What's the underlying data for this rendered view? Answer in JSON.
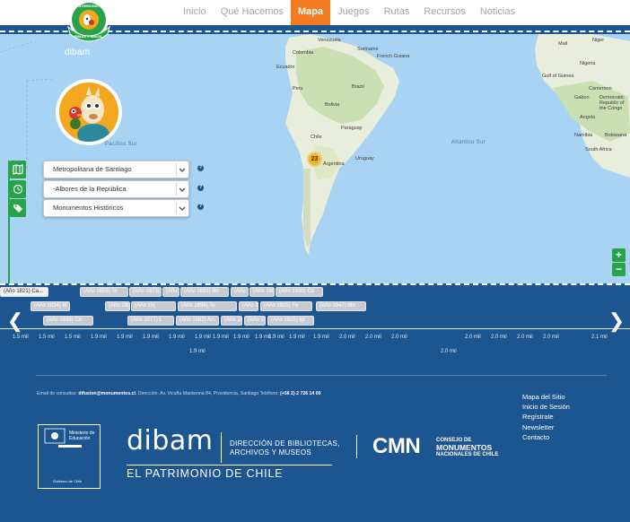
{
  "nav": {
    "items": [
      "Inicio",
      "Qué Hacemos",
      "Mapa",
      "Juegos",
      "Rutas",
      "Recursos",
      "Noticias"
    ],
    "active": "Mapa"
  },
  "logo": {
    "badge_top": "PATRIMONIO",
    "badge_bottom": "RIMAS Y NIÑOS",
    "brand": "dibam"
  },
  "map": {
    "ocean_labels": [
      "Pacífico Sur",
      "Atlántico Sur"
    ],
    "country_labels": [
      "Venezuela",
      "Colombia",
      "Suriname",
      "French Guiana",
      "Ecuador",
      "Peru",
      "Brazil",
      "Bolivia",
      "Paraguay",
      "Chile",
      "Argentina",
      "Uruguay",
      "Mali",
      "Niger",
      "Nigeria",
      "Cameroon",
      "Gabon",
      "Democratic Republic of the Congo",
      "Angola",
      "Namibia",
      "Botswana",
      "South Africa",
      "Gulf of Guinea"
    ],
    "cluster_count": "23",
    "zoom_in": "+",
    "zoom_out": "−"
  },
  "filters": [
    {
      "icon": "map-icon",
      "value": "Metropolitana de Santiago",
      "help": "?"
    },
    {
      "icon": "clock-icon",
      "value": "-Albores de la República",
      "help": "?"
    },
    {
      "icon": "tag-icon",
      "value": "Monumentos Históricos",
      "help": "?"
    }
  ],
  "timeline": {
    "events_row1": [
      "(Año 1821) Ca...",
      "(Año 1853) Te",
      "(Año 1873) De",
      "(Año 1",
      "(Año 1893) Bo",
      "(Año",
      "(Año 18(",
      "(Año 1930) Ca"
    ],
    "events_row2": [
      "(Año 1834) Id",
      "(Año 18(",
      "(Año 18(",
      "(Año 1896) Te",
      "(Año 1",
      "(Año 1925) Fu",
      "(Año 1947) Mo"
    ],
    "events_row3": [
      "(Año 1838) Co",
      "(Año 1877) L",
      "(Año 1882) Arc",
      "(Año 18",
      "(Año 18",
      "(Año 1925) Igl"
    ],
    "ticks": [
      "1.5 mil",
      "1.5 mil",
      "1.5 mil",
      "1.9 mil",
      "1.9 mil",
      "1.9 mil",
      "1.9 mil",
      "1.9 mil",
      "1.9 mil",
      "1.9 mil",
      "1.9 mil",
      "1.9 mil",
      "1.9 mil",
      "1.9 mil",
      "2.0 mil",
      "2.0 mil",
      "2.0 mil",
      "2.0 mil",
      "2.0 mil",
      "2.0 mil",
      "2.0 mil",
      "2.1 mil"
    ],
    "majors": [
      "1.9 mil",
      "2.0 mil"
    ],
    "prev": "❮",
    "next": "❯"
  },
  "footer": {
    "contact_prefix": "Email de consultas: ",
    "email": "difusion@monumentos.cl",
    "address": ". Dirección: Av. Vicuña Mackenna 84, Providencia, Santiago Teléfono: ",
    "phone": "(+56 2) 2 726 14 00",
    "links": [
      "Mapa del Sitio",
      "Inicio de Sesión",
      "Regístrate",
      "Newsletter",
      "Contacto"
    ],
    "mineduc_line1": "Ministerio de",
    "mineduc_line2": "Educación",
    "gobierno": "Gobierno de Chile",
    "dibam": "dibam",
    "dibam_desc1": "DIRECCIÓN DE BIBLIOTECAS,",
    "dibam_desc2": "ARCHIVOS Y MUSEOS",
    "patrimonio": "EL PATRIMONIO DE CHILE",
    "cmn": "CMN",
    "cmn_line1": "CONSEJO DE",
    "cmn_line2": "MONUMENTOS",
    "cmn_line3": "NACIONALES DE CHILE"
  }
}
